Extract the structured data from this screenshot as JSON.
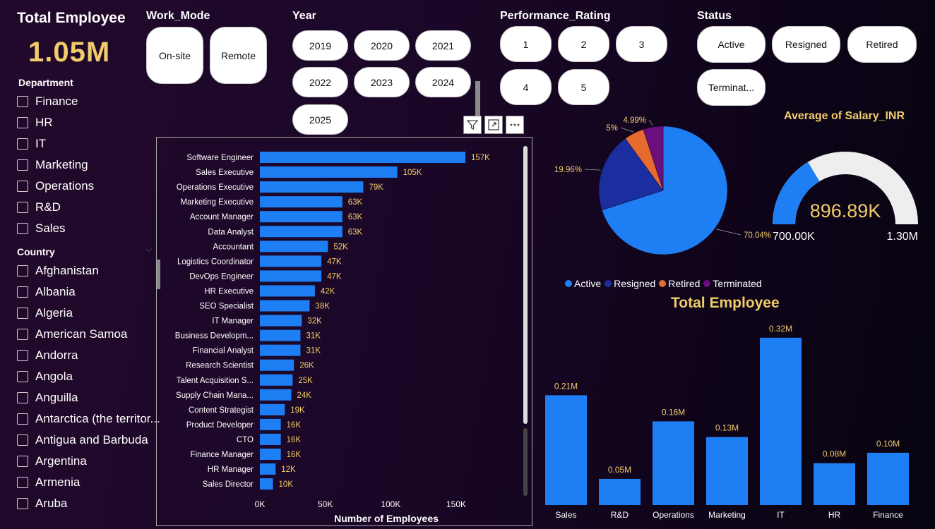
{
  "card": {
    "title": "Total Employee",
    "value": "1.05M"
  },
  "work_mode": {
    "title": "Work_Mode",
    "options": [
      "On-site",
      "Remote"
    ]
  },
  "year": {
    "title": "Year",
    "options": [
      "2019",
      "2020",
      "2021",
      "2022",
      "2023",
      "2024",
      "2025"
    ]
  },
  "performance": {
    "title": "Performance_Rating",
    "options": [
      "1",
      "2",
      "3",
      "4",
      "5"
    ]
  },
  "status": {
    "title": "Status",
    "options": [
      "Active",
      "Resigned",
      "Retired",
      "Terminat..."
    ]
  },
  "department": {
    "title": "Department",
    "items": [
      "Finance",
      "HR",
      "IT",
      "Marketing",
      "Operations",
      "R&D",
      "Sales"
    ]
  },
  "country": {
    "title": "Country",
    "items": [
      "Afghanistan",
      "Albania",
      "Algeria",
      "American Samoa",
      "Andorra",
      "Angola",
      "Anguilla",
      "Antarctica (the territor...",
      "Antigua and Barbuda",
      "Argentina",
      "Armenia",
      "Aruba"
    ]
  },
  "colors": {
    "bar": "#1e7ff5",
    "label": "#f0cc6a",
    "active": "#1e7ff5",
    "resigned": "#1a2ea0",
    "retired": "#e66b2e",
    "terminated": "#6a0f7d",
    "gauge_track": "#eeeeee"
  },
  "chart_data": [
    {
      "type": "bar",
      "orientation": "horizontal",
      "xlabel": "Number of Employees",
      "xlim": [
        0,
        175000
      ],
      "xticks": [
        "0K",
        "50K",
        "100K",
        "150K"
      ],
      "categories": [
        "Software Engineer",
        "Sales Executive",
        "Operations Executive",
        "Marketing Executive",
        "Account Manager",
        "Data Analyst",
        "Accountant",
        "Logistics Coordinator",
        "DevOps Engineer",
        "HR Executive",
        "SEO Specialist",
        "IT Manager",
        "Business Developm...",
        "Financial Analyst",
        "Research Scientist",
        "Talent Acquisition S...",
        "Supply Chain Mana...",
        "Content Strategist",
        "Product Developer",
        "CTO",
        "Finance Manager",
        "HR Manager",
        "Sales Director"
      ],
      "values": [
        157000,
        105000,
        79000,
        63000,
        63000,
        63000,
        52000,
        47000,
        47000,
        42000,
        38000,
        32000,
        31000,
        31000,
        26000,
        25000,
        24000,
        19000,
        16000,
        16000,
        16000,
        12000,
        10000
      ],
      "data_labels": [
        "157K",
        "105K",
        "79K",
        "63K",
        "63K",
        "63K",
        "52K",
        "47K",
        "47K",
        "42K",
        "38K",
        "32K",
        "31K",
        "31K",
        "26K",
        "25K",
        "24K",
        "19K",
        "16K",
        "16K",
        "16K",
        "12K",
        "10K"
      ]
    },
    {
      "type": "pie",
      "categories": [
        "Active",
        "Resigned",
        "Retired",
        "Terminated"
      ],
      "values": [
        70.04,
        19.96,
        5.0,
        4.99
      ],
      "data_labels": [
        "70.04%",
        "19.96%",
        "5%",
        "4.99%"
      ],
      "legend": "bottom"
    },
    {
      "type": "gauge",
      "title": "Average of Salary_INR",
      "value": 896890,
      "value_label": "896.89K",
      "min": 700000,
      "min_label": "700.00K",
      "max": 1300000,
      "max_label": "1.30M"
    },
    {
      "type": "bar",
      "title": "Total Employee",
      "categories": [
        "Sales",
        "R&D",
        "Operations",
        "Marketing",
        "IT",
        "HR",
        "Finance"
      ],
      "values": [
        0.21,
        0.05,
        0.16,
        0.13,
        0.32,
        0.08,
        0.1
      ],
      "data_labels": [
        "0.21M",
        "0.05M",
        "0.16M",
        "0.13M",
        "0.32M",
        "0.08M",
        "0.10M"
      ],
      "ylim": [
        0,
        0.34
      ]
    }
  ]
}
